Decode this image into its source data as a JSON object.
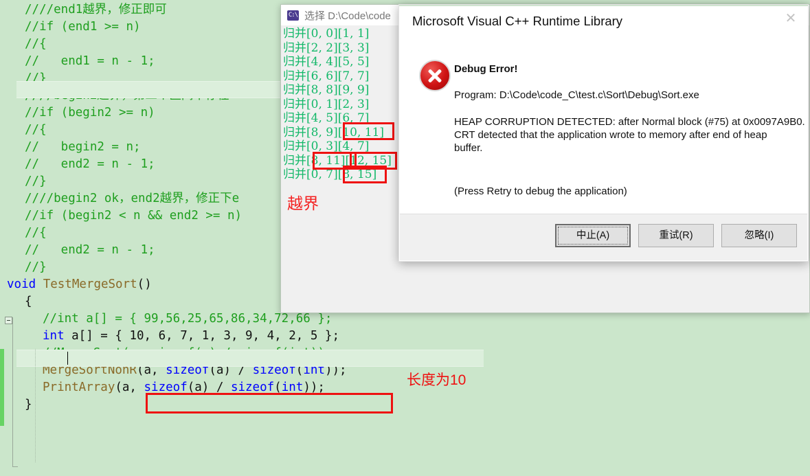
{
  "editor": {
    "name": "visual-studio-code-editor",
    "background_color": "#cbe6cb",
    "comment_color": "#1f9f1f",
    "keyword_color": "#0000ff",
    "function_color": "#8a6a28",
    "lines": [
      {
        "indent": 1,
        "segments": [
          {
            "t": "////end1越界，修正即可",
            "c": "comment"
          }
        ]
      },
      {
        "indent": 1,
        "segments": [
          {
            "t": "//if (end1 >= n)",
            "c": "comment"
          }
        ]
      },
      {
        "indent": 1,
        "segments": [
          {
            "t": "//{",
            "c": "comment"
          }
        ]
      },
      {
        "indent": 1,
        "segments": [
          {
            "t": "//   end1 = n - 1;",
            "c": "comment"
          }
        ]
      },
      {
        "indent": 1,
        "segments": [
          {
            "t": "//}",
            "c": "comment"
          }
        ]
      },
      {
        "indent": 1,
        "segments": [
          {
            "t": "////begin2越界，第二个区间不存在",
            "c": "comment"
          }
        ]
      },
      {
        "indent": 1,
        "segments": [
          {
            "t": "//if (begin2 >= n)",
            "c": "comment"
          }
        ]
      },
      {
        "indent": 1,
        "segments": [
          {
            "t": "//{",
            "c": "comment"
          }
        ]
      },
      {
        "indent": 1,
        "segments": [
          {
            "t": "//   begin2 = n;",
            "c": "comment"
          }
        ]
      },
      {
        "indent": 1,
        "segments": [
          {
            "t": "//   end2 = n - 1;",
            "c": "comment"
          }
        ]
      },
      {
        "indent": 1,
        "segments": [
          {
            "t": "//}",
            "c": "comment"
          }
        ]
      },
      {
        "indent": 1,
        "segments": [
          {
            "t": "////begin2 ok，end2越界，修正下e",
            "c": "comment"
          }
        ]
      },
      {
        "indent": 1,
        "segments": [
          {
            "t": "//if (begin2 < n && end2 >= n)",
            "c": "comment"
          }
        ]
      },
      {
        "indent": 1,
        "segments": [
          {
            "t": "//{",
            "c": "comment"
          }
        ]
      },
      {
        "indent": 1,
        "segments": [
          {
            "t": "//   end2 = n - 1;",
            "c": "comment"
          }
        ]
      },
      {
        "indent": 1,
        "segments": [
          {
            "t": "//}",
            "c": "comment"
          }
        ]
      },
      {
        "indent": 0,
        "segments": [
          {
            "t": "void",
            "c": "kw"
          },
          {
            "t": " ",
            "c": "plain"
          },
          {
            "t": "TestMergeSort",
            "c": "fn"
          },
          {
            "t": "()",
            "c": "plain"
          }
        ]
      },
      {
        "indent": 1,
        "segments": [
          {
            "t": "{",
            "c": "plain"
          }
        ]
      },
      {
        "indent": 2,
        "segments": [
          {
            "t": "//int a[] = { 99,56,25,65,86,34,72,66 };",
            "c": "comment"
          }
        ]
      },
      {
        "indent": 2,
        "segments": [
          {
            "t": "int",
            "c": "kw"
          },
          {
            "t": " a[] = { ",
            "c": "plain"
          },
          {
            "t": "10, 6, 7, 1, 3, 9, 4, 2, 5",
            "c": "plain"
          },
          {
            "t": " };",
            "c": "plain"
          }
        ]
      },
      {
        "indent": 2,
        "segments": [
          {
            "t": "//MergeSort(a, sizeof(a) / sizeof(int));",
            "c": "comment"
          }
        ]
      },
      {
        "indent": 2,
        "segments": [
          {
            "t": "MergeSortNonR",
            "c": "fn"
          },
          {
            "t": "(a, ",
            "c": "plain"
          },
          {
            "t": "sizeof",
            "c": "kw"
          },
          {
            "t": "(a) / ",
            "c": "plain"
          },
          {
            "t": "sizeof",
            "c": "kw"
          },
          {
            "t": "(",
            "c": "plain"
          },
          {
            "t": "int",
            "c": "kw"
          },
          {
            "t": "));",
            "c": "plain"
          }
        ]
      },
      {
        "indent": 2,
        "segments": [
          {
            "t": "PrintArray",
            "c": "fn"
          },
          {
            "t": "(a, ",
            "c": "plain"
          },
          {
            "t": "sizeof",
            "c": "kw"
          },
          {
            "t": "(a) / ",
            "c": "plain"
          },
          {
            "t": "sizeof",
            "c": "kw"
          },
          {
            "t": "(",
            "c": "plain"
          },
          {
            "t": "int",
            "c": "kw"
          },
          {
            "t": "));",
            "c": "plain"
          }
        ]
      },
      {
        "indent": 1,
        "segments": [
          {
            "t": "}",
            "c": "plain"
          }
        ]
      }
    ],
    "annotations": [
      {
        "name": "array-literal-highlight-box",
        "label": "",
        "color": "#ee1111"
      },
      {
        "name": "array-length-note",
        "label": "长度为10",
        "color": "#ee1111"
      }
    ]
  },
  "console": {
    "name": "windows-console-window",
    "title": "选择 D:\\Code\\code",
    "icon": "console-icon",
    "text_color": "#13b869",
    "lines": [
      "归并[0, 0][1, 1]",
      "归并[2, 2][3, 3]",
      "归并[4, 4][5, 5]",
      "归并[6, 6][7, 7]",
      "归并[8, 8][9, 9]",
      "归并[0, 1][2, 3]",
      "归并[4, 5][6, 7]",
      "归并[8, 9][10, 11]",
      "归并[0, 3][4, 7]",
      "归并[8, 11][12, 15]",
      "归并[0, 7][8, 15]"
    ],
    "annotation_note": "越界",
    "annotation_color": "#f42222"
  },
  "dialog": {
    "name": "msvc-runtime-library-dialog",
    "title": "Microsoft Visual C++ Runtime Library",
    "close_icon": "✕",
    "error_icon": "error-icon",
    "heading": "Debug Error!",
    "program_line": "Program: D:\\Code\\code_C\\test.c\\Sort\\Debug\\Sort.exe",
    "message_line1": "HEAP CORRUPTION DETECTED: after Normal block (#75) at 0x0097A9B0.",
    "message_line2": "CRT detected that the application wrote to memory after end of heap",
    "message_line3": "buffer.",
    "hint": "(Press Retry to debug the application)",
    "buttons": [
      {
        "label": "中止(A)",
        "name": "abort-button",
        "default": true
      },
      {
        "label": "重试(R)",
        "name": "retry-button",
        "default": false
      },
      {
        "label": "忽略(I)",
        "name": "ignore-button",
        "default": false
      }
    ]
  }
}
